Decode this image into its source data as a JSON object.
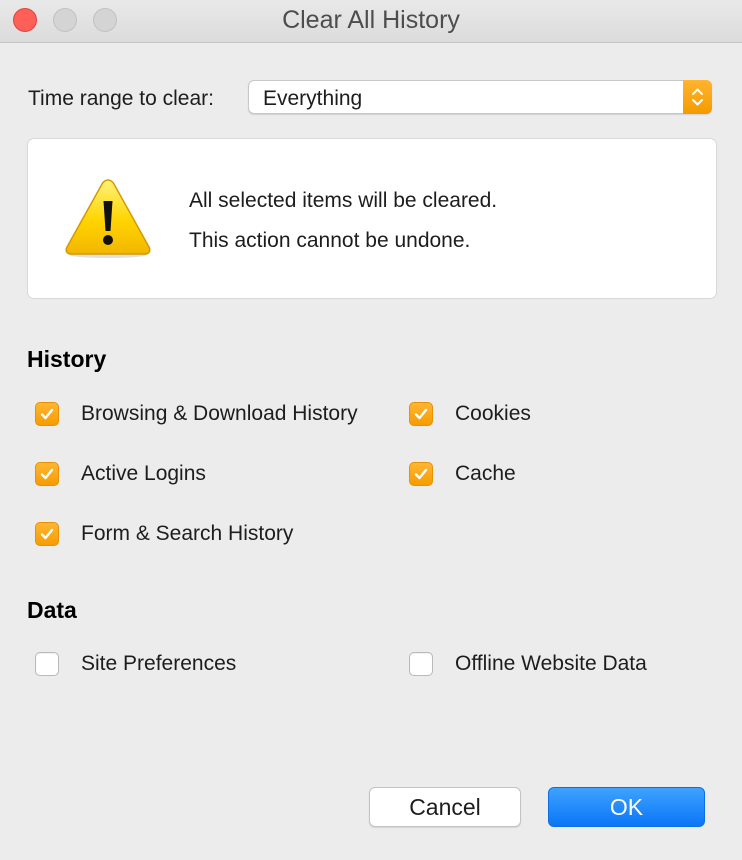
{
  "window": {
    "title": "Clear All History"
  },
  "time_range": {
    "label": "Time range to clear:",
    "selected": "Everything"
  },
  "warning": {
    "icon": "warning-icon",
    "line1": "All selected items will be cleared.",
    "line2": "This action cannot be undone."
  },
  "history": {
    "heading": "History",
    "items": [
      {
        "label": "Browsing & Download History",
        "checked": true
      },
      {
        "label": "Cookies",
        "checked": true
      },
      {
        "label": "Active Logins",
        "checked": true
      },
      {
        "label": "Cache",
        "checked": true
      },
      {
        "label": "Form & Search History",
        "checked": true
      }
    ]
  },
  "data": {
    "heading": "Data",
    "items": [
      {
        "label": "Site Preferences",
        "checked": false
      },
      {
        "label": "Offline Website Data",
        "checked": false
      }
    ]
  },
  "buttons": {
    "cancel": "Cancel",
    "ok": "OK"
  },
  "colors": {
    "accent": "#f69c00",
    "primary_button": "#0a76f6"
  }
}
